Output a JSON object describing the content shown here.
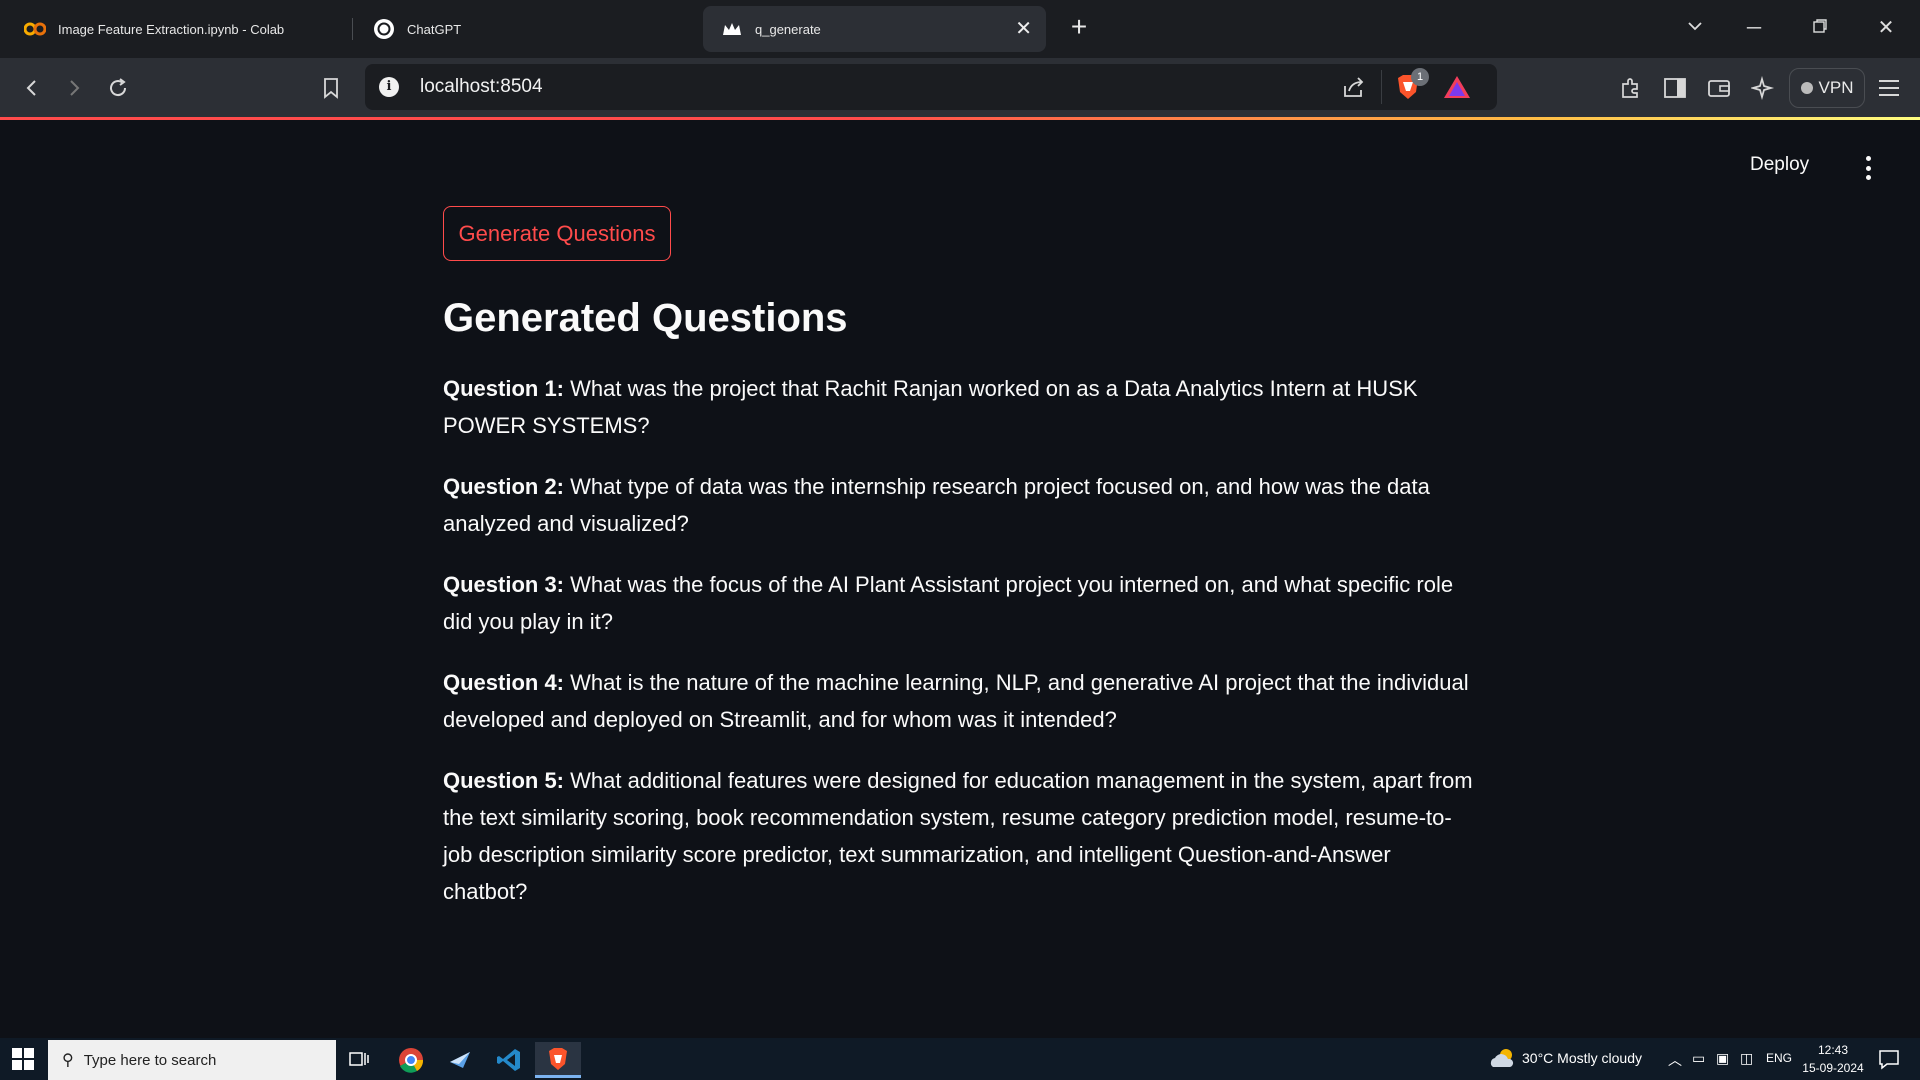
{
  "browser": {
    "tabs": [
      {
        "label": "Image Feature Extraction.ipynb - Colab",
        "icon": "colab-icon"
      },
      {
        "label": "ChatGPT",
        "icon": "chatgpt-icon"
      },
      {
        "label": "q_generate",
        "icon": "streamlit-crown-icon",
        "active": true
      }
    ],
    "url": "localhost:8504",
    "brave_badge": "1",
    "vpn_label": "VPN"
  },
  "app": {
    "deploy_label": "Deploy",
    "generate_button_label": "Generate Questions",
    "heading": "Generated Questions",
    "questions": [
      {
        "label": "Question 1:",
        "text": " What was the project that Rachit Ranjan worked on as a Data Analytics Intern at HUSK POWER SYSTEMS?"
      },
      {
        "label": "Question 2:",
        "text": " What type of data was the internship research project focused on, and how was the data analyzed and visualized?"
      },
      {
        "label": "Question 3:",
        "text": " What was the focus of the AI Plant Assistant project you interned on, and what specific role did you play in it?"
      },
      {
        "label": "Question 4:",
        "text": " What is the nature of the machine learning, NLP, and generative AI project that the individual developed and deployed on Streamlit, and for whom was it intended?"
      },
      {
        "label": "Question 5:",
        "text": " What additional features were designed for education management in the system, apart from the text similarity scoring, book recommendation system, resume category prediction model, resume-to-job description similarity score predictor, text summarization, and intelligent Question-and-Answer chatbot?"
      }
    ],
    "accent_color": "#ff4b4b",
    "background_color": "#0e1117"
  },
  "taskbar": {
    "search_placeholder": "Type here to search",
    "weather": "30°C  Mostly cloudy",
    "language": "ENG",
    "time": "12:43",
    "date": "15-09-2024"
  }
}
